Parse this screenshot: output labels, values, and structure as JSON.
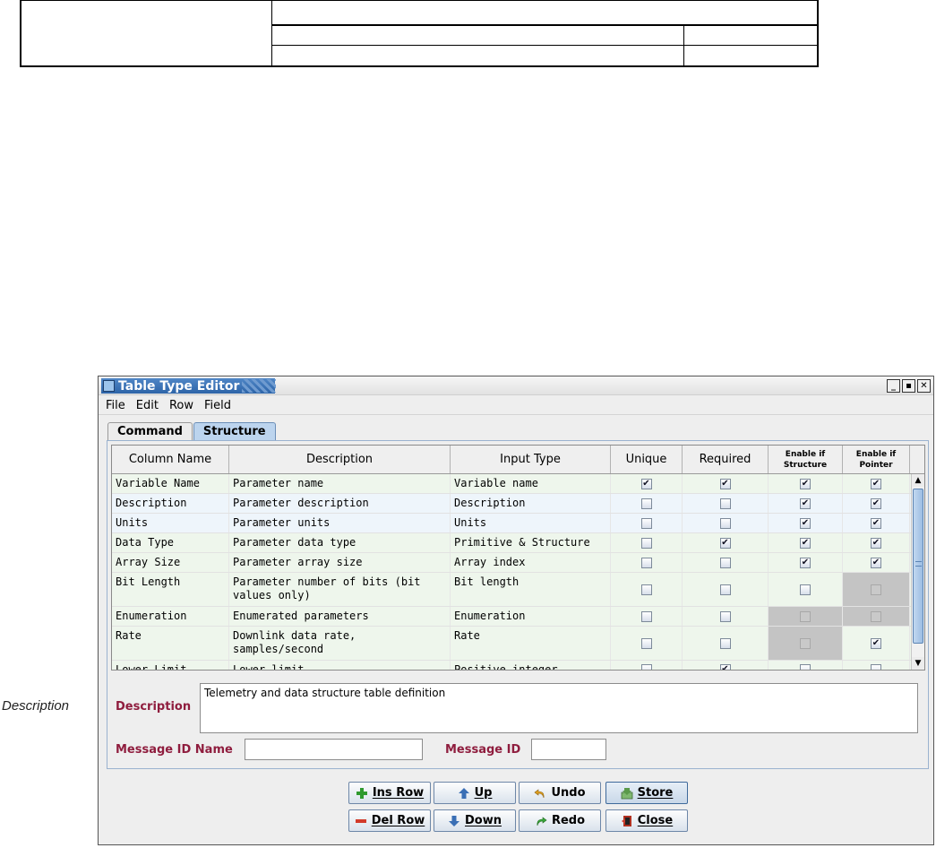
{
  "page": {
    "side_label": "Description"
  },
  "window": {
    "title": "Table Type Editor",
    "menu": [
      "File",
      "Edit",
      "Row",
      "Field"
    ],
    "tabs": [
      "Command",
      "Structure"
    ],
    "active_tab": "Structure"
  },
  "grid": {
    "columns": [
      "Column Name",
      "Description",
      "Input Type",
      "Unique",
      "Required",
      "Enable if Structure",
      "Enable if Pointer"
    ],
    "rows": [
      {
        "name": "Variable Name",
        "desc": "Parameter name",
        "type": "Variable name",
        "unique": true,
        "required": true,
        "structure": true,
        "pointer": true
      },
      {
        "name": "Description",
        "desc": "Parameter description",
        "type": "Description",
        "unique": false,
        "required": false,
        "structure": true,
        "pointer": true
      },
      {
        "name": "Units",
        "desc": "Parameter units",
        "type": "Units",
        "unique": false,
        "required": false,
        "structure": true,
        "pointer": true
      },
      {
        "name": "Data Type",
        "desc": "Parameter data type",
        "type": "Primitive & Structure",
        "unique": false,
        "required": true,
        "structure": true,
        "pointer": true
      },
      {
        "name": "Array Size",
        "desc": "Parameter array size",
        "type": "Array index",
        "unique": false,
        "required": false,
        "structure": true,
        "pointer": true
      },
      {
        "name": "Bit Length",
        "desc": "Parameter number of bits (bit values only)",
        "type": "Bit length",
        "unique": false,
        "required": false,
        "structure": false,
        "pointer": false,
        "pointer_disabled": true
      },
      {
        "name": "Enumeration",
        "desc": "Enumerated parameters",
        "type": "Enumeration",
        "unique": false,
        "required": false,
        "structure": false,
        "pointer": false,
        "structure_disabled": true,
        "pointer_disabled": true
      },
      {
        "name": "Rate",
        "desc": "Downlink data rate, samples/second",
        "type": "Rate",
        "unique": false,
        "required": false,
        "structure": false,
        "pointer": true,
        "structure_disabled": true
      },
      {
        "name": "Lower Limit",
        "desc": "Lower limit",
        "type": "Positive integer",
        "unique": false,
        "required": true,
        "structure": false,
        "pointer": false
      }
    ]
  },
  "fields": {
    "description_label": "Description",
    "description_value": "Telemetry and data structure table definition",
    "message_id_name_label": "Message ID Name",
    "message_id_name_value": "",
    "message_id_label": "Message ID",
    "message_id_value": ""
  },
  "buttons": {
    "ins_row": "Ins Row",
    "up": "Up",
    "undo": "Undo",
    "store": "Store",
    "del_row": "Del Row",
    "down": "Down",
    "redo": "Redo",
    "close": "Close"
  },
  "colors": {
    "label_color": "#8f1d3e",
    "row_tint_green": "#eef6ec",
    "row_tint_blue": "#eef5fb",
    "title_bar": "#2d64a8"
  }
}
